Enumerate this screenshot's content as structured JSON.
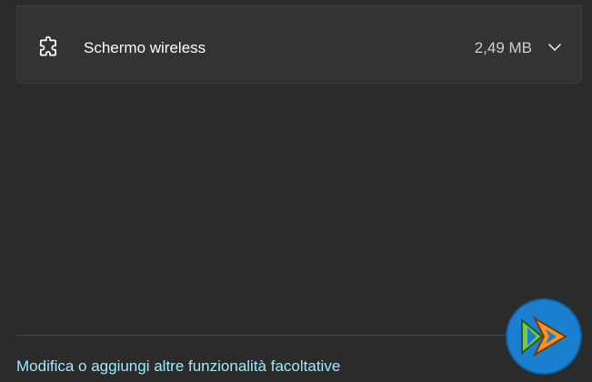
{
  "feature": {
    "name": "Schermo wireless",
    "size": "2,49 MB",
    "icon": "puzzle-icon",
    "expand_icon": "chevron-down-icon"
  },
  "footer": {
    "link_label": "Modifica o aggiungi altre funzionalità facoltative"
  },
  "logo": {
    "icon": "site-logo"
  },
  "colors": {
    "background": "#2b2b2b",
    "card": "#333333",
    "link": "#99ebff",
    "logo_blue": "#1a7fd1",
    "logo_green": "#7ac943",
    "logo_orange": "#f7931e"
  }
}
